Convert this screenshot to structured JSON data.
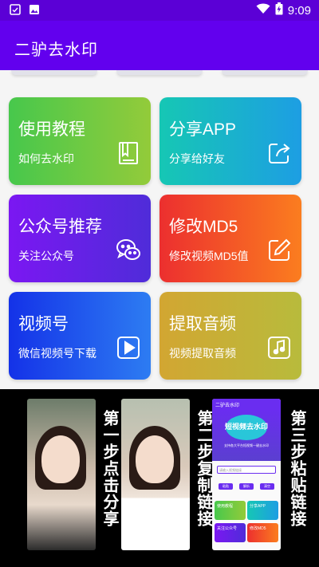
{
  "status_bar": {
    "time": "9:09",
    "left_icons": [
      "notification-icon",
      "image-icon"
    ],
    "right_icons": [
      "wifi-icon",
      "battery-charging-icon"
    ]
  },
  "app_bar": {
    "title": "二驴去水印"
  },
  "cards": [
    {
      "title": "使用教程",
      "subtitle": "如何去水印",
      "icon": "book-icon"
    },
    {
      "title": "分享APP",
      "subtitle": "分享给好友",
      "icon": "share-icon"
    },
    {
      "title": "公众号推荐",
      "subtitle": "关注公众号",
      "icon": "wechat-icon"
    },
    {
      "title": "修改MD5",
      "subtitle": "修改视频MD5值",
      "icon": "edit-icon"
    },
    {
      "title": "视频号",
      "subtitle": "微信视频号下载",
      "icon": "play-icon"
    },
    {
      "title": "提取音频",
      "subtitle": "视频提取音频",
      "icon": "music-note-icon"
    }
  ],
  "banner": {
    "steps": [
      "第一步点击分享",
      "第二步复制链接",
      "第三步粘贴链接"
    ],
    "mini_app": {
      "title": "二驴去水印",
      "hero_title": "短视频去水印",
      "hero_subtitle": "支持各大平台短视频一键去水印",
      "input_placeholder": "请输入视频链接",
      "buttons": [
        "粘贴",
        "解析",
        "清空"
      ],
      "cards": [
        "使用教程",
        "分享APP",
        "关注公众号",
        "修改MD5"
      ]
    }
  }
}
